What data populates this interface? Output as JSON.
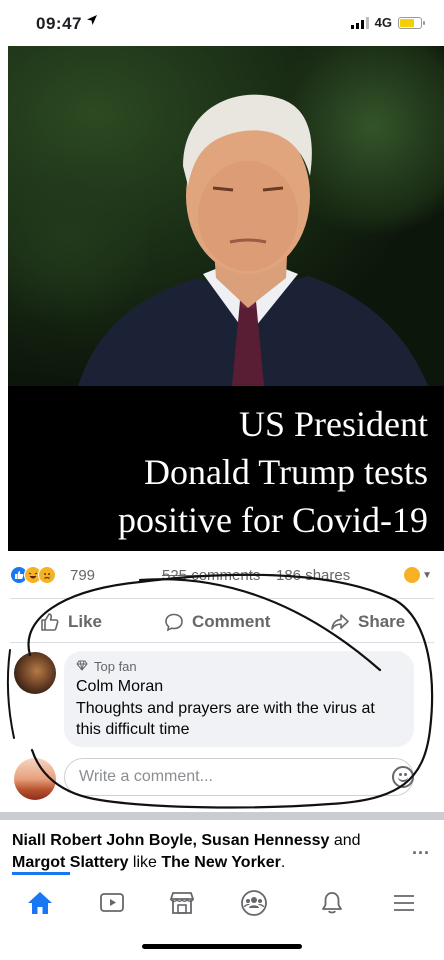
{
  "status_bar": {
    "time": "09:47",
    "network": "4G",
    "battery_level": 0.7,
    "icons": [
      "location-arrow-icon",
      "signal-bars-icon",
      "battery-icon"
    ]
  },
  "post": {
    "image_caption": [
      "US President",
      "Donald Trump tests",
      "positive for Covid-19"
    ],
    "reaction_count": "799",
    "comments_count": "525 comments",
    "shares_count": "186 shares",
    "reaction_icons": [
      "like-reaction-icon",
      "haha-reaction-icon",
      "sad-reaction-icon"
    ]
  },
  "actions": {
    "like": "Like",
    "comment": "Comment",
    "share": "Share"
  },
  "comment": {
    "badge": "Top fan",
    "author": "Colm Moran",
    "text": "Thoughts and prayers are with the virus at this difficult time"
  },
  "write_comment": {
    "placeholder": "Write a comment..."
  },
  "next_story": {
    "names": "Niall Robert John Boyle, Susan Hennessy",
    "and": " and ",
    "names2": "Margot Slattery",
    "like": " like ",
    "page": "The New Yorker",
    "end": ".",
    "more": "..."
  },
  "nav": {
    "items": [
      "home-icon",
      "watch-icon",
      "marketplace-icon",
      "groups-icon",
      "notifications-icon",
      "menu-icon"
    ],
    "active": "home",
    "accent_color": "#1877f2"
  }
}
